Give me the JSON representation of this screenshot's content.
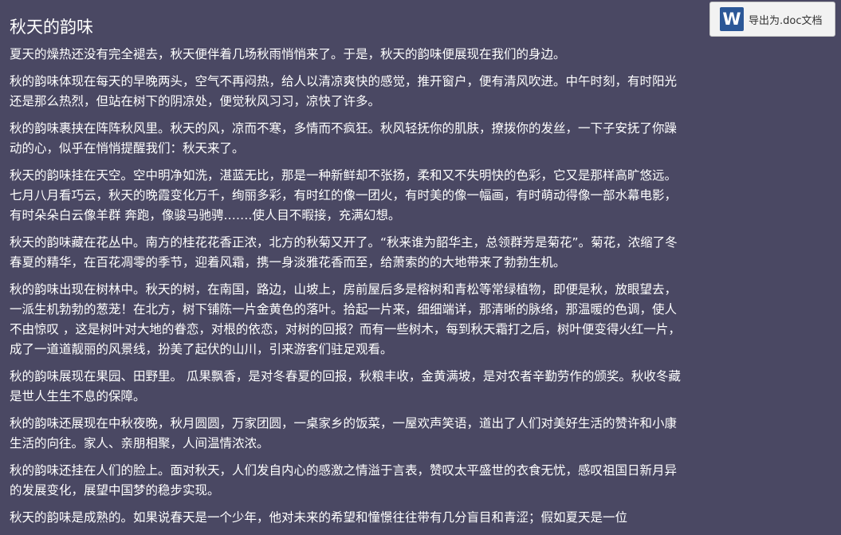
{
  "export": {
    "icon_letter": "W",
    "label": "导出为.doc文档"
  },
  "article": {
    "title": "秋天的韵味",
    "paragraphs": [
      "夏天的燥热还没有完全褪去，秋天便伴着几场秋雨悄悄来了。于是，秋天的韵味便展现在我们的身边。",
      "秋的韵味体现在每天的早晚两头，空气不再闷热，给人以清凉爽快的感觉，推开窗户，便有清风吹进。中午时刻，有时阳光还是那么热烈，但站在树下的阴凉处，便觉秋风习习，凉快了许多。",
      "秋的韵味裹挟在阵阵秋风里。秋天的风，凉而不寒，多情而不疯狂。秋风轻抚你的肌肤，撩拨你的发丝，一下子安抚了你躁动的心，似乎在悄悄提醒我们：秋天来了。",
      "秋天的韵味挂在天空。空中明净如洗，湛蓝无比，那是一种新鲜却不张扬，柔和又不失明快的色彩，它又是那样高旷悠远。 七月八月看巧云，秋天的晚霞变化万千，绚丽多彩，有时红的像一团火，有时美的像一幅画，有时萌动得像一部水幕电影，有时朵朵白云像羊群 奔跑，像骏马驰骋…….使人目不暇接，充满幻想。",
      "秋天的韵味藏在花丛中。南方的桂花花香正浓，北方的秋菊又开了。“秋来谁为韶华主，总领群芳是菊花”。菊花，浓缩了冬春夏的精华，在百花凋零的季节，迎着风霜，携一身淡雅花香而至，给萧索的的大地带来了勃勃生机。",
      "秋的韵味出现在树林中。秋天的树，在南国，路边，山坡上，房前屋后多是榕树和青松等常绿植物，即便是秋，放眼望去，一派生机勃勃的葱茏！在北方，树下铺陈一片金黄色的落叶。拾起一片来，细细端详，那清晰的脉络，那温暖的色调，使人不由惊叹 ，这是树叶对大地的眷恋，对根的依恋，对树的回报？而有一些树木，每到秋天霜打之后，树叶便变得火红一片，成了一道道靓丽的风景线，扮美了起伏的山川，引来游客们驻足观看。",
      "秋的韵味展现在果园、田野里。 瓜果飘香，是对冬春夏的回报，秋粮丰收，金黄满坡，是对农者辛勤劳作的颁奖。秋收冬藏是世人生生不息的保障。",
      "秋的韵味还展现在中秋夜晚，秋月圆圆，万家团圆，一桌家乡的饭菜，一屋欢声笑语，道出了人们对美好生活的赞许和小康生活的向往。家人、亲朋相聚，人间温情浓浓。",
      "秋的韵味还挂在人们的脸上。面对秋天，人们发自内心的感激之情溢于言表，赞叹太平盛世的衣食无忧，感叹祖国日新月异的发展变化，展望中国梦的稳步实现。",
      "秋天的韵味是成熟的。如果说春天是一个少年，他对未来的希望和憧憬往往带有几分盲目和青涩；假如夏天是一位"
    ]
  }
}
